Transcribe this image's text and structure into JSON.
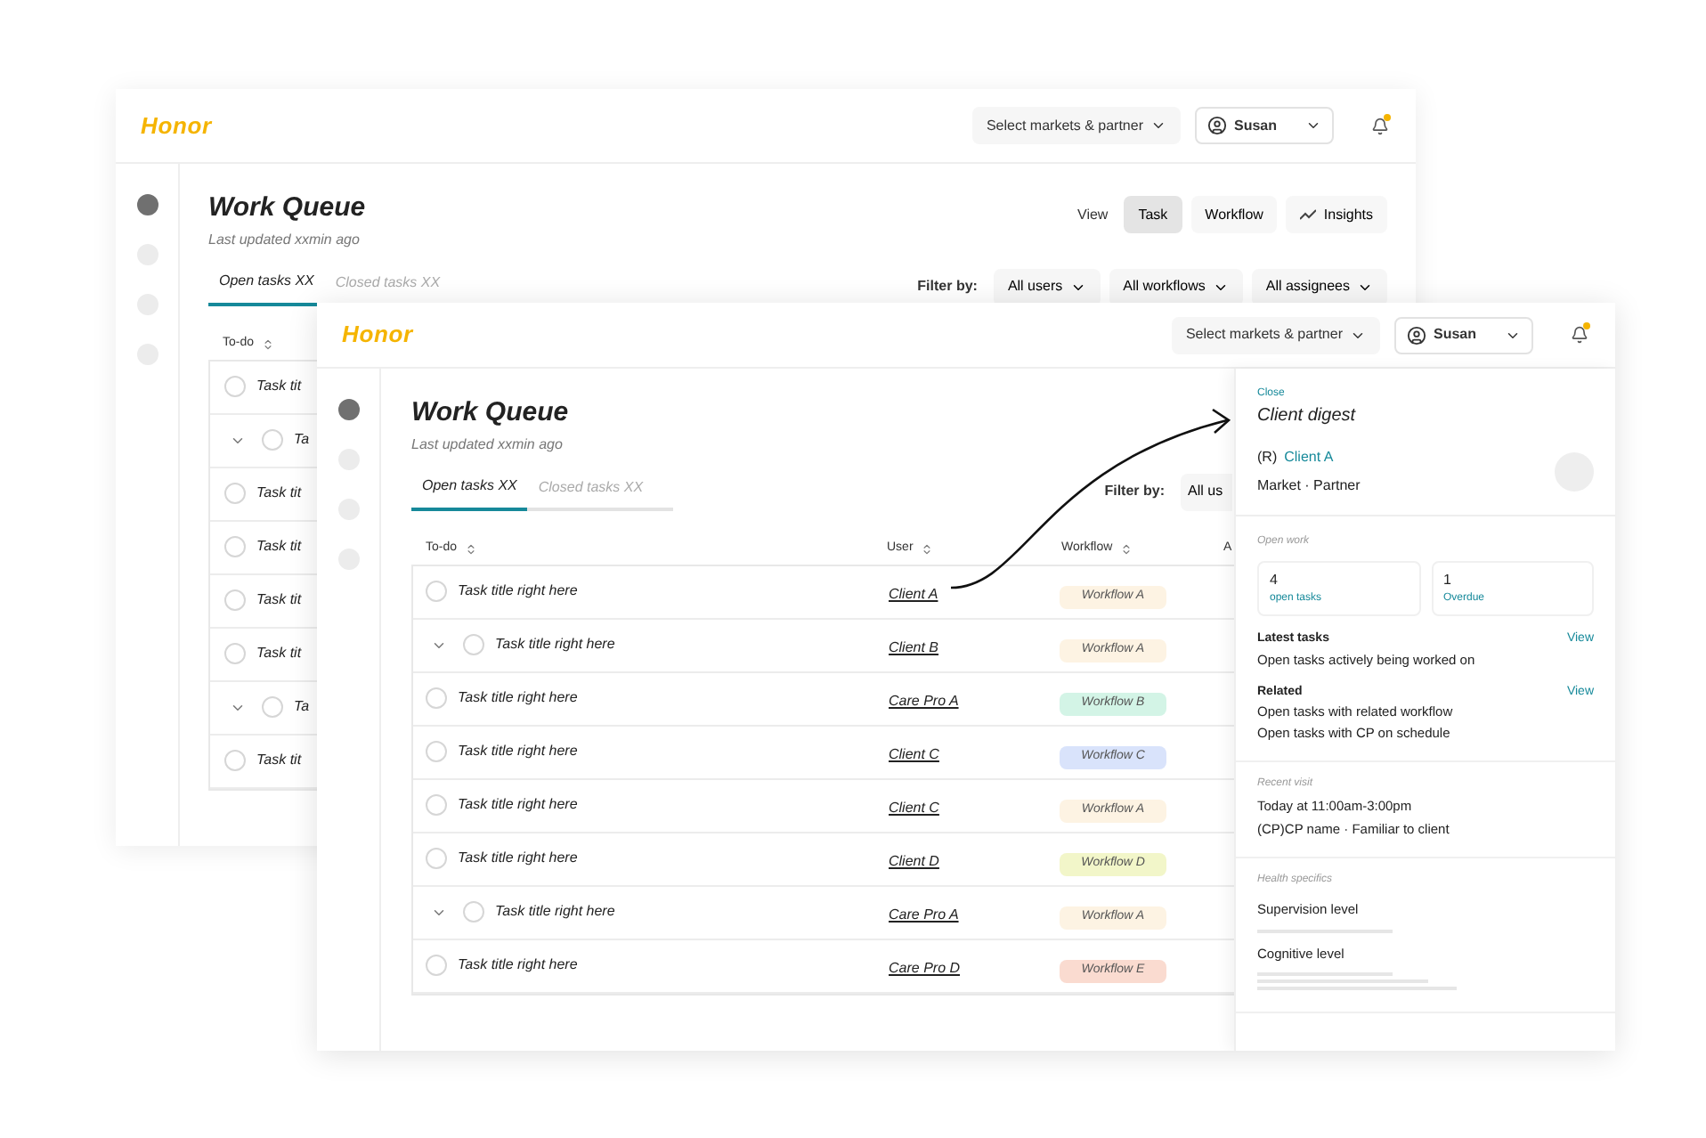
{
  "back_window": {
    "header": {
      "logo": "Honor",
      "market_select": "Select markets & partner",
      "user": "Susan",
      "notification": true
    },
    "sidebar": {
      "items": [
        {
          "selected": true
        },
        {
          "selected": false
        },
        {
          "selected": false
        },
        {
          "selected": false
        }
      ]
    },
    "title": "Work Queue",
    "subtitle": "Last updated xxmin ago",
    "view": {
      "label": "View",
      "options": [
        {
          "label": "Task",
          "selected": true
        },
        {
          "label": "Workflow",
          "selected": false
        },
        {
          "label": "Insights",
          "selected": false
        }
      ]
    },
    "tabs": [
      {
        "label": "Open tasks XX",
        "selected": true
      },
      {
        "label": "Closed tasks XX",
        "selected": false
      }
    ],
    "filter": {
      "label": "Filter by:",
      "options": [
        "All users",
        "All workflows",
        "All assignees"
      ]
    },
    "table": {
      "columns": [
        "To-do"
      ],
      "rows": [
        {
          "kind": "task",
          "checked": false,
          "title": "Task tit"
        },
        {
          "kind": "parent",
          "checked": false,
          "title": "Ta"
        },
        {
          "kind": "task",
          "checked": false,
          "title": "Task tit"
        },
        {
          "kind": "task",
          "checked": false,
          "title": "Task tit"
        },
        {
          "kind": "task",
          "checked": false,
          "title": "Task tit"
        },
        {
          "kind": "task",
          "checked": false,
          "title": "Task tit"
        },
        {
          "kind": "parent",
          "checked": false,
          "title": "Ta"
        },
        {
          "kind": "task",
          "checked": false,
          "title": "Task tit"
        }
      ]
    }
  },
  "front_window": {
    "header": {
      "logo": "Honor",
      "market_select": "Select markets & partner",
      "user": "Susan",
      "notification": true
    },
    "sidebar": {
      "items": [
        {
          "selected": true
        },
        {
          "selected": false
        },
        {
          "selected": false
        },
        {
          "selected": false
        }
      ]
    },
    "title": "Work Queue",
    "subtitle": "Last updated xxmin ago",
    "tabs": [
      {
        "label": "Open tasks XX",
        "selected": true
      },
      {
        "label": "Closed tasks XX",
        "selected": false
      }
    ],
    "filter": {
      "label": "Filter by:",
      "options": [
        "All us"
      ]
    },
    "table": {
      "columns": [
        "To-do",
        "User",
        "Workflow",
        "A"
      ],
      "rows": [
        {
          "kind": "task",
          "checked": false,
          "title": "Task title right here",
          "user": "Client A",
          "workflow": {
            "label": "Workflow A",
            "color": "#fdf3e3"
          }
        },
        {
          "kind": "parent",
          "checked": false,
          "title": "Task title right here",
          "user": "Client B",
          "workflow": {
            "label": "Workflow A",
            "color": "#fdf3e3"
          }
        },
        {
          "kind": "task",
          "checked": false,
          "title": "Task title right here",
          "user": "Care Pro A",
          "workflow": {
            "label": "Workflow B",
            "color": "#d3f4e6"
          }
        },
        {
          "kind": "task",
          "checked": false,
          "title": "Task title right here",
          "user": "Client C",
          "workflow": {
            "label": "Workflow C",
            "color": "#d9e3fb"
          }
        },
        {
          "kind": "task",
          "checked": false,
          "title": "Task title right here",
          "user": "Client C",
          "workflow": {
            "label": "Workflow A",
            "color": "#fdf3e3"
          }
        },
        {
          "kind": "task",
          "checked": false,
          "title": "Task title right here",
          "user": "Client D",
          "workflow": {
            "label": "Workflow D",
            "color": "#f2f6c9"
          }
        },
        {
          "kind": "parent",
          "checked": false,
          "title": "Task title right here",
          "user": "Care Pro A",
          "workflow": {
            "label": "Workflow A",
            "color": "#fdf3e3"
          }
        },
        {
          "kind": "task",
          "checked": false,
          "title": "Task title right here",
          "user": "Care Pro D",
          "workflow": {
            "label": "Workflow E",
            "color": "#fadbd0"
          }
        }
      ]
    }
  },
  "drawer": {
    "close": "Close",
    "title": "Client digest",
    "client_prefix": "(R)",
    "client_name": "Client A",
    "client_meta": "Market · Partner",
    "open_work": {
      "label": "Open work",
      "stats": [
        {
          "value": "4",
          "label": "open tasks"
        },
        {
          "value": "1",
          "label": "Overdue"
        }
      ]
    },
    "groups": [
      {
        "title": "Latest tasks",
        "action": "View",
        "lines": [
          "Open tasks actively being worked on"
        ]
      },
      {
        "title": "Related",
        "action": "View",
        "lines": [
          "Open tasks with related workflow",
          "Open tasks with CP on schedule"
        ]
      }
    ],
    "recent_visit": {
      "label": "Recent visit",
      "lines": [
        "Today at 11:00am-3:00pm",
        "(CP)CP name · Familiar to client"
      ]
    },
    "health": {
      "label": "Health specifics",
      "items": [
        {
          "label": "Supervision level",
          "kind": "single"
        },
        {
          "label": "Cognitive level",
          "kind": "multi"
        }
      ]
    }
  }
}
